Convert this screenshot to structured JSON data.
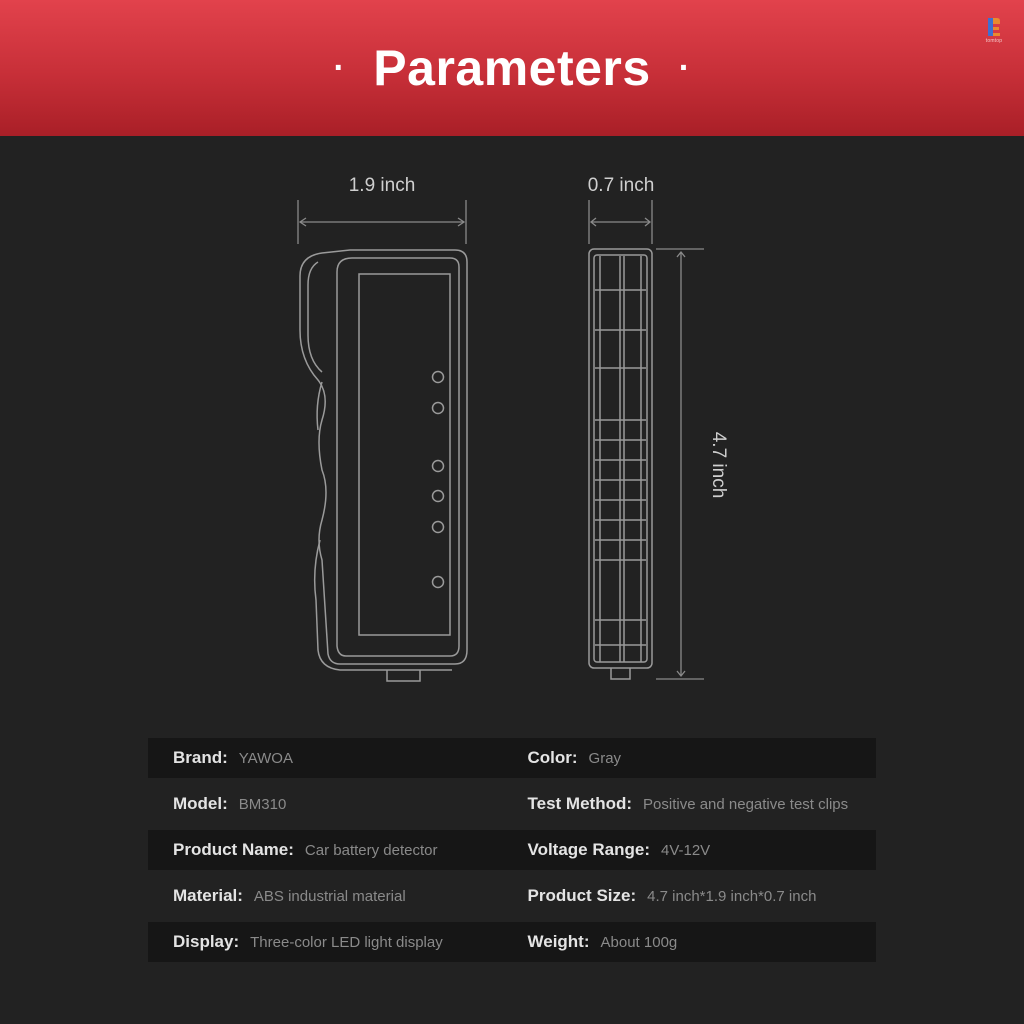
{
  "header": {
    "title": "Parameters",
    "bullet_left": "·",
    "bullet_right": "·",
    "logo_text": "tomtop",
    "colors": {
      "banner_top": "#e2424c",
      "banner_bottom": "#a91f27"
    }
  },
  "dimensions": {
    "width": "1.9 inch",
    "depth": "0.7 inch",
    "height": "4.7 inch"
  },
  "specs": {
    "rows": [
      {
        "left_key": "Brand:",
        "left_val": "YAWOA",
        "right_key": "Color:",
        "right_val": "Gray"
      },
      {
        "left_key": "Model:",
        "left_val": "BM310",
        "right_key": "Test Method:",
        "right_val": "Positive and negative test clips"
      },
      {
        "left_key": "Product Name:",
        "left_val": "Car battery detector",
        "right_key": "Voltage Range:",
        "right_val": "4V-12V"
      },
      {
        "left_key": "Material:",
        "left_val": "ABS industrial material",
        "right_key": "Product Size:",
        "right_val": "4.7 inch*1.9 inch*0.7 inch"
      },
      {
        "left_key": "Display:",
        "left_val": "Three-color LED light display",
        "right_key": "Weight:",
        "right_val": "About 100g"
      }
    ]
  },
  "icons": {
    "logo": "tomtop-logo-icon",
    "front_view": "device-front-outline",
    "side_view": "device-side-outline"
  }
}
